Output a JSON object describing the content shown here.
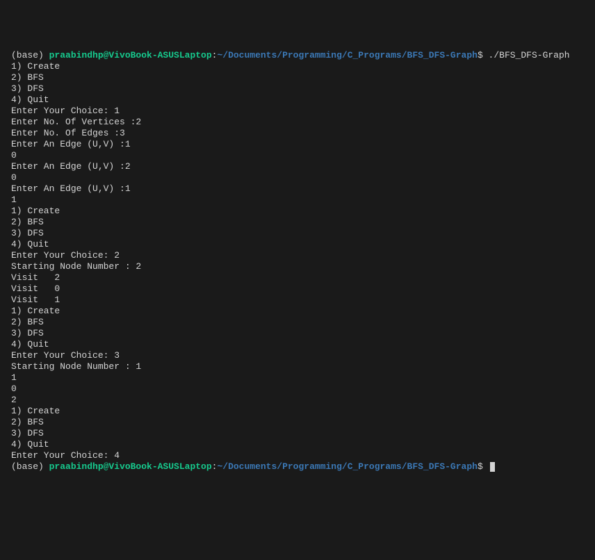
{
  "prompt1": {
    "env": "(base) ",
    "user_host": "praabindhp@VivoBook-ASUSLaptop",
    "colon": ":",
    "path": "~/Documents/Programming/C_Programs/BFS_DFS-Graph",
    "dollar": "$",
    "command": " ./BFS_DFS-Graph"
  },
  "output_lines": [
    "",
    "1) Create",
    "2) BFS",
    "3) DFS",
    "4) Quit",
    "Enter Your Choice: 1",
    "",
    "Enter No. Of Vertices :2",
    "",
    "Enter No. Of Edges :3",
    "",
    "Enter An Edge (U,V) :1",
    "0",
    "",
    "Enter An Edge (U,V) :2",
    "0",
    "",
    "Enter An Edge (U,V) :1",
    "1",
    "",
    "1) Create",
    "2) BFS",
    "3) DFS",
    "4) Quit",
    "Enter Your Choice: 2",
    "",
    "Starting Node Number : 2",
    "",
    "Visit   2",
    "Visit   0",
    "Visit   1",
    "1) Create",
    "2) BFS",
    "3) DFS",
    "4) Quit",
    "Enter Your Choice: 3",
    "",
    "Starting Node Number : 1",
    "",
    "1",
    "0",
    "2",
    "1) Create",
    "2) BFS",
    "3) DFS",
    "4) Quit",
    "Enter Your Choice: 4"
  ],
  "prompt2": {
    "env": "(base) ",
    "user_host": "praabindhp@VivoBook-ASUSLaptop",
    "colon": ":",
    "path": "~/Documents/Programming/C_Programs/BFS_DFS-Graph",
    "dollar": "$"
  }
}
